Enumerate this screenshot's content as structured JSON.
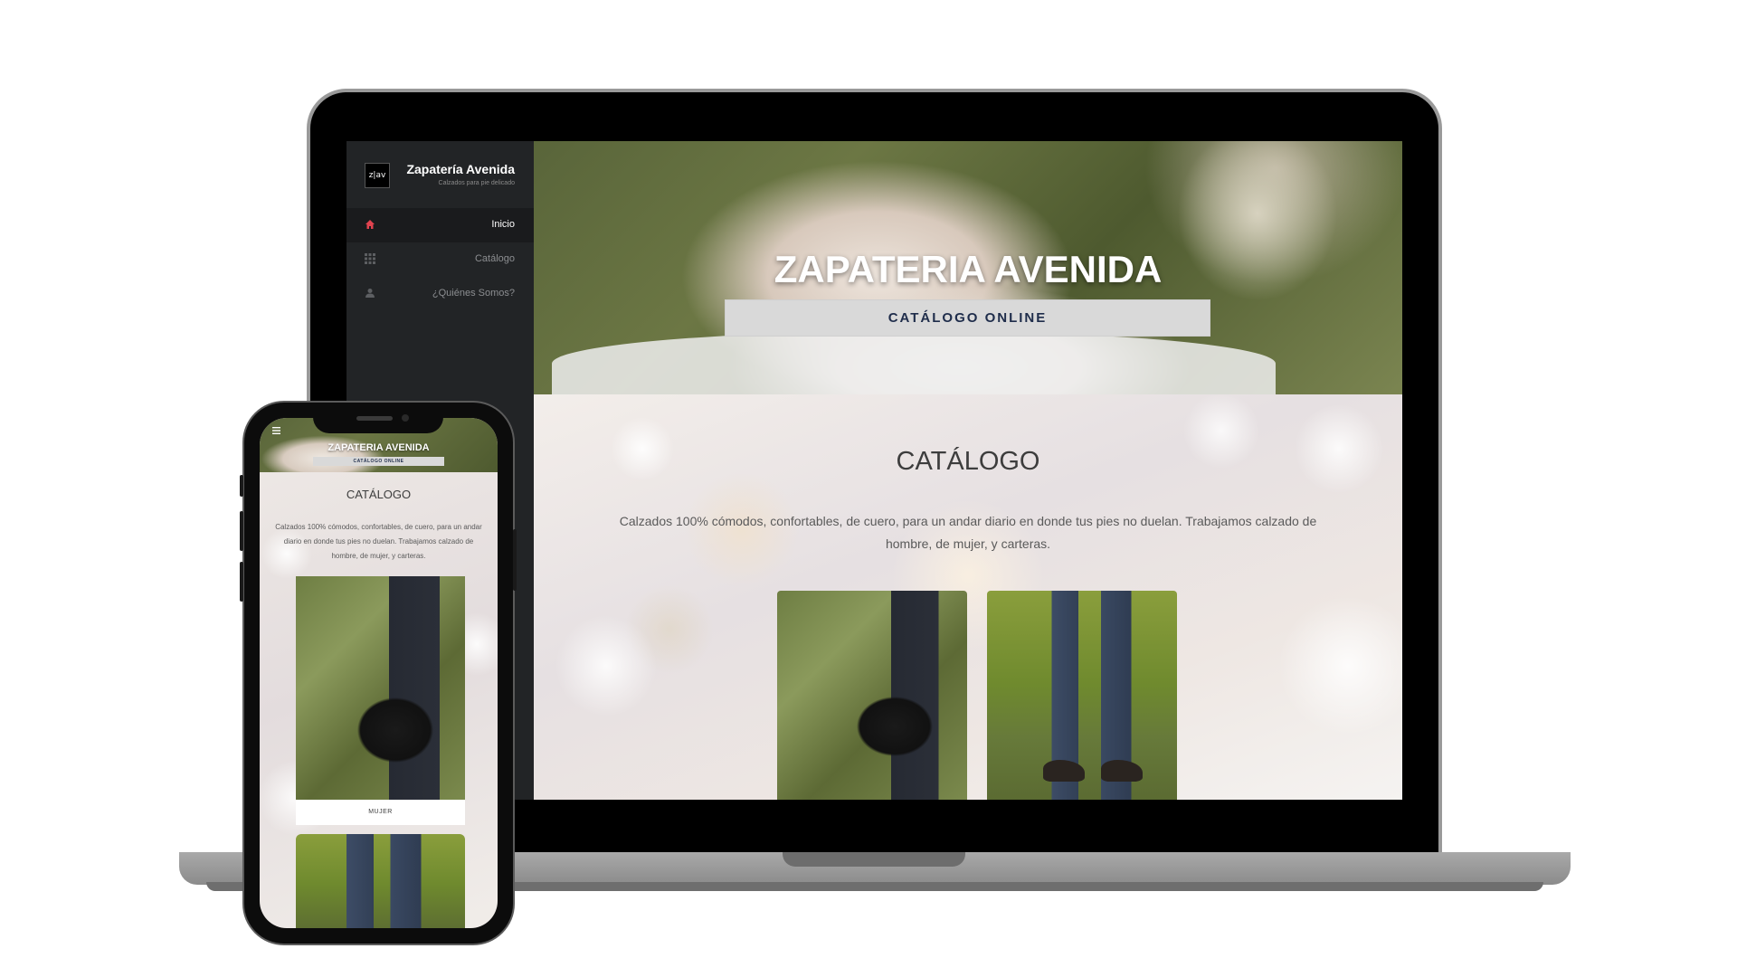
{
  "colors": {
    "sidebar_bg": "#222426",
    "active_icon": "#e0434f",
    "hero_button_text": "#1f2d4b",
    "hero_button_bg": "#d9d9d9"
  },
  "sidebar": {
    "logo_text": "z|av",
    "brand_name": "Zapatería Avenida",
    "brand_tagline": "Calzados para pie delicado",
    "items": [
      {
        "label": "Inicio",
        "icon": "home-icon",
        "active": true
      },
      {
        "label": "Catálogo",
        "icon": "grid-icon",
        "active": false
      },
      {
        "label": "¿Quiénes Somos?",
        "icon": "user-icon",
        "active": false
      }
    ]
  },
  "hero": {
    "title": "ZAPATERIA AVENIDA",
    "button_label": "CATÁLOGO ONLINE"
  },
  "catalog": {
    "title": "CATÁLOGO",
    "description": "Calzados 100% cómodos, confortables, de cuero, para un andar diario en donde tus pies no duelan. Trabajamos calzado de hombre, de mujer, y carteras.",
    "cards": [
      {
        "image": "women-black-ankle-boot-photo",
        "label": "MUJER"
      },
      {
        "image": "men-black-lace-up-shoes-photo"
      }
    ]
  },
  "mobile": {
    "menu_icon": "hamburger-icon",
    "hero_title": "ZAPATERIA AVENIDA",
    "hero_button_label": "CATÁLOGO ONLINE",
    "catalog_title": "CATÁLOGO",
    "catalog_description": "Calzados 100% cómodos, confortables, de cuero, para un andar diario en donde tus pies no duelan. Trabajamos calzado de hombre, de mujer, y carteras.",
    "card_1_label": "MUJER"
  }
}
